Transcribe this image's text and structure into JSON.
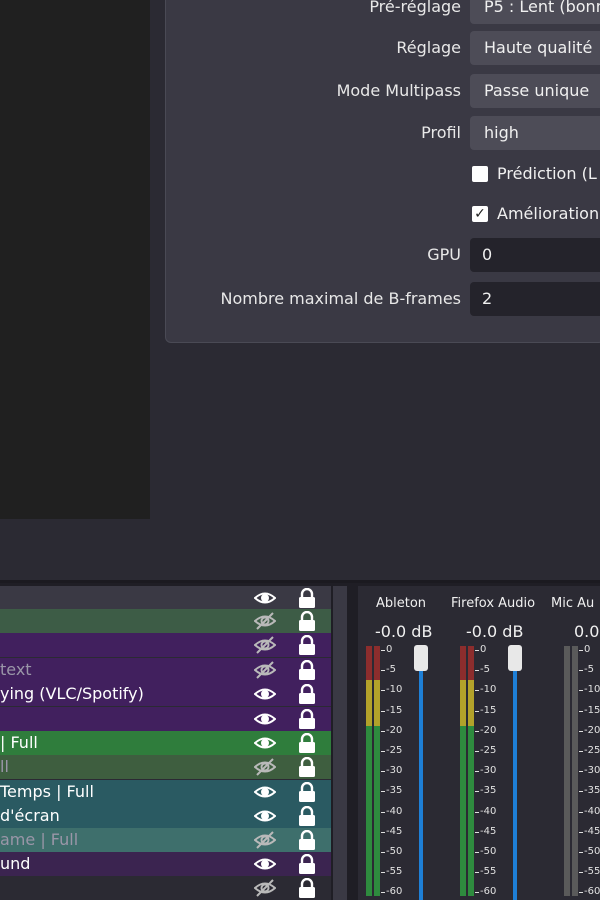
{
  "encoder_settings": {
    "rows": [
      {
        "label": "Pré-réglage",
        "value": "P5 : Lent (bonne",
        "kind": "dropdown"
      },
      {
        "label": "Réglage",
        "value": "Haute qualité",
        "kind": "dropdown"
      },
      {
        "label": "Mode Multipass",
        "value": "Passe unique",
        "kind": "dropdown"
      },
      {
        "label": "Profil",
        "value": "high",
        "kind": "dropdown"
      }
    ],
    "checkboxes": [
      {
        "label": "Prédiction (L",
        "checked": false
      },
      {
        "label": "Amélioration",
        "checked": true
      }
    ],
    "gpu": {
      "label": "GPU",
      "value": "0"
    },
    "bframes": {
      "label": "Nombre maximal de B-frames",
      "value": "2"
    }
  },
  "sources": [
    {
      "name": "",
      "bg": "#3a3944",
      "visible": true,
      "dim": false
    },
    {
      "name": "",
      "bg": "#3d5c46",
      "visible": false,
      "dim": false
    },
    {
      "name": "",
      "bg": "#41205e",
      "visible": false,
      "dim": true
    },
    {
      "name": "text",
      "bg": "#41205e",
      "visible": false,
      "dim": true
    },
    {
      "name": "ying (VLC/Spotify)",
      "bg": "#41205e",
      "visible": true,
      "dim": false
    },
    {
      "name": "",
      "bg": "#41205e",
      "visible": true,
      "dim": false
    },
    {
      "name": "| Full",
      "bg": "#2f7d3c",
      "visible": true,
      "dim": false
    },
    {
      "name": "ll",
      "bg": "#3e5e3f",
      "visible": false,
      "dim": true
    },
    {
      "name": "Temps | Full",
      "bg": "#2a5a62",
      "visible": true,
      "dim": false
    },
    {
      "name": "d'écran",
      "bg": "#2a5a62",
      "visible": true,
      "dim": false
    },
    {
      "name": "ame | Full",
      "bg": "#3e6f6c",
      "visible": false,
      "dim": true
    },
    {
      "name": "und",
      "bg": "#3b2450",
      "visible": true,
      "dim": false
    },
    {
      "name": "",
      "bg": "#2b2a33",
      "visible": false,
      "dim": false
    }
  ],
  "mixer": {
    "channels": [
      {
        "name": "Ableton",
        "db": "-0.0 dB"
      },
      {
        "name": "Firefox Audio",
        "db": "-0.0 dB"
      },
      {
        "name": "Mic Au",
        "db": "0.0"
      }
    ],
    "scale": [
      "0",
      "-5",
      "-10",
      "-15",
      "-20",
      "-25",
      "-30",
      "-35",
      "-40",
      "-45",
      "-50",
      "-55",
      "-60"
    ]
  },
  "colors": {
    "meter_green": "#2e8b3e",
    "meter_yellow": "#b3a22a",
    "meter_red": "#8c2d2d",
    "slider": "#1e7fd6"
  }
}
